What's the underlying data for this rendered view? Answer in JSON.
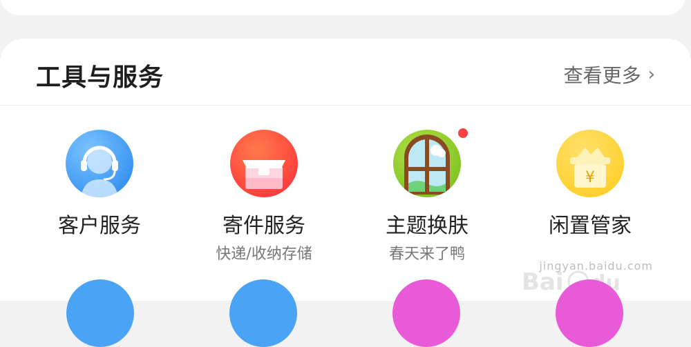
{
  "section": {
    "title": "工具与服务",
    "more_label": "查看更多",
    "more_icon": "chevron-right-icon"
  },
  "tools": [
    {
      "label": "客户服务",
      "sub": "",
      "icon": "customer-service-headset-icon",
      "color": "#4aa3f5"
    },
    {
      "label": "寄件服务",
      "sub": "快递/收纳存储",
      "icon": "package-box-icon",
      "color": "#ff5a3c"
    },
    {
      "label": "主题换肤",
      "sub": "春天来了鸭",
      "icon": "window-theme-icon",
      "color": "#8acb1f",
      "badge": "red-dot"
    },
    {
      "label": "闲置管家",
      "sub": "",
      "icon": "yuan-treasure-box-icon",
      "color": "#ffd53d"
    }
  ],
  "watermark": {
    "url": "jingyan.baidu.com"
  },
  "colors": {
    "background": "#f2f2f2",
    "card": "#ffffff",
    "badge": "#ff4141"
  }
}
